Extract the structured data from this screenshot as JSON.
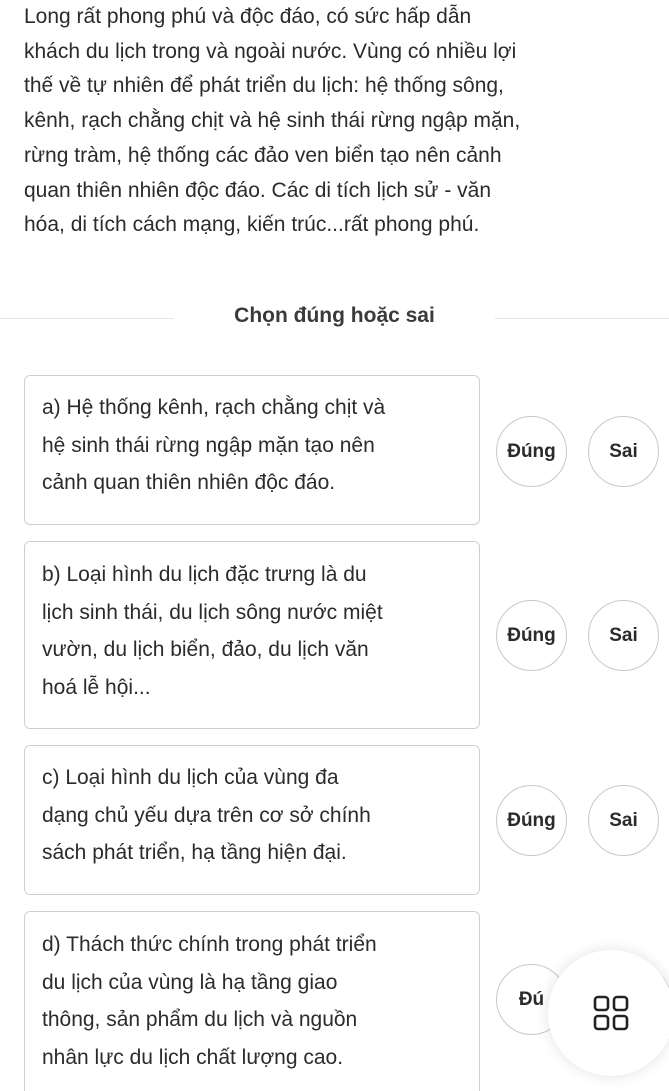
{
  "passage": {
    "lines": [
      "Long rất phong phú và độc đáo, có sức hấp dẫn",
      "khách du lịch trong và ngoài nước. Vùng có nhiều lợi",
      "thế về tự nhiên để phát triển du lịch: hệ thống sông,",
      "kênh, rạch chằng chịt và hệ sinh thái rừng ngập mặn,",
      "rừng tràm, hệ thống các đảo ven biển tạo nên cảnh",
      "quan thiên nhiên độc đáo. Các di tích lịch sử - văn",
      "hóa, di tích cách mạng, kiến trúc...rất phong phú."
    ]
  },
  "section": {
    "title": "Chọn đúng hoặc sai"
  },
  "statements": [
    {
      "lines": [
        "a) Hệ thống kênh, rạch chằng chịt và",
        "hệ sinh thái rừng ngập mặn tạo nên",
        "cảnh quan thiên nhiên độc đáo."
      ],
      "true_label": "Đúng",
      "false_label": "Sai"
    },
    {
      "lines": [
        "b) Loại hình du lịch đặc trưng là du",
        "lịch sinh thái, du lịch sông nước miệt",
        "vườn, du lịch biển, đảo, du lịch văn",
        "hoá lễ hội..."
      ],
      "true_label": "Đúng",
      "false_label": "Sai"
    },
    {
      "lines": [
        "c) Loại hình du lịch của vùng đa",
        "dạng chủ yếu dựa trên cơ sở chính",
        "sách phát triển, hạ tầng hiện đại."
      ],
      "true_label": "Đúng",
      "false_label": "Sai"
    },
    {
      "lines": [
        "d) Thách thức chính trong phát triển",
        "du lịch của vùng là hạ tầng giao",
        "thông, sản phẩm du lịch và nguồn",
        "nhân lực du lịch chất lượng cao."
      ],
      "true_label": "Đú"
    }
  ],
  "floating_menu": {
    "icon": "grid-icon"
  }
}
